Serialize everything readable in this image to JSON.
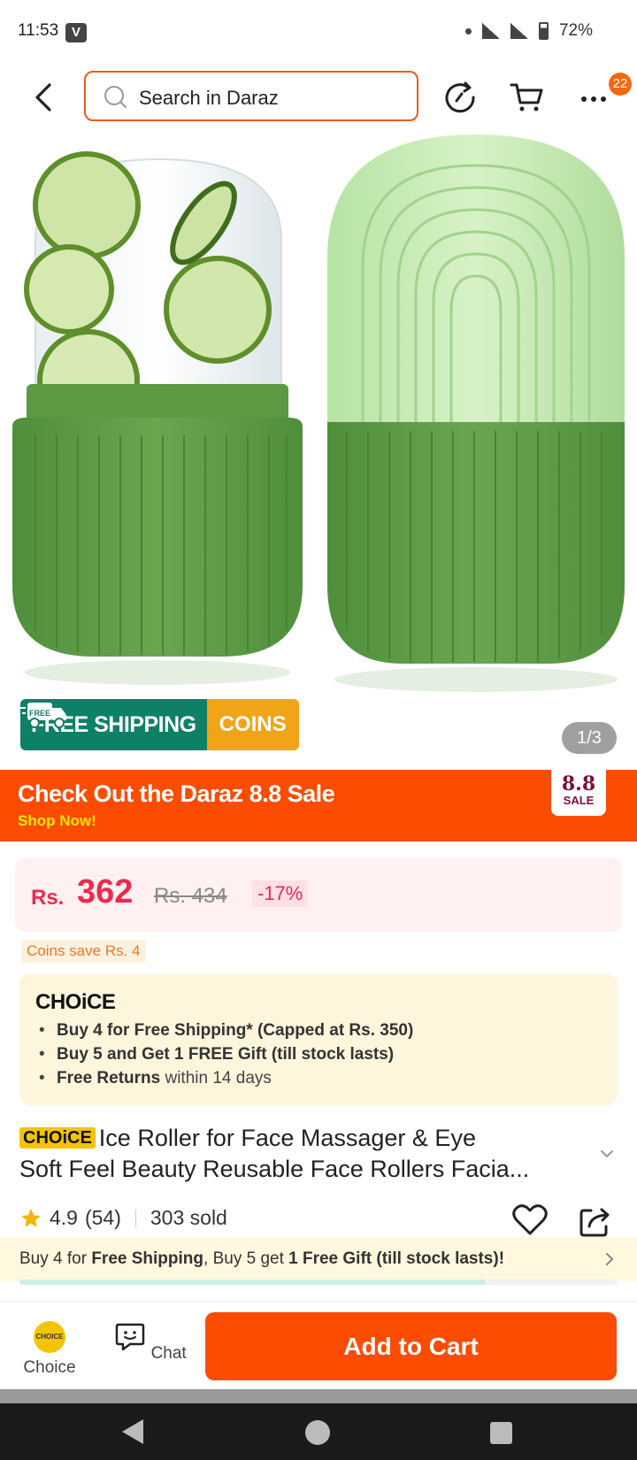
{
  "status": {
    "time": "11:53",
    "badge": "V",
    "battery": "72%"
  },
  "search": {
    "placeholder": "Search in Daraz"
  },
  "header": {
    "cart_badge": "22"
  },
  "gallery": {
    "counter": "1/3",
    "ship_tag": "FREE",
    "ship_label": "FREE SHIPPING",
    "coins_label": "COINS"
  },
  "sale": {
    "title": "Check Out the  Daraz 8.8 Sale",
    "cta": "Shop Now!",
    "logo_num": "8.8",
    "logo_word": "SALE"
  },
  "price": {
    "currency": "Rs.",
    "value": "362",
    "old": "Rs. 434",
    "discount": "-17%",
    "coins_save": "Coins save Rs. 4"
  },
  "choice": {
    "logo": "CHOiCE",
    "items": [
      {
        "bold": "Buy 4 for  Free Shipping* (Capped at Rs. 350)",
        "rest": ""
      },
      {
        "bold": "Buy 5 and Get 1 FREE Gift (till stock lasts)",
        "rest": ""
      },
      {
        "bold": "Free Returns",
        "rest": " within 14 days"
      }
    ]
  },
  "product": {
    "badge": "CHOiCE",
    "title_line1": "Ice Roller for Face Massager & Eye",
    "title_line2": "Soft Feel Beauty  Reusable Face Rollers Facia...",
    "rating": "4.9",
    "reviews": "(54)",
    "sold": "303 sold"
  },
  "promo": {
    "p1": "Buy 4 for ",
    "b1": "Free Shipping",
    "p2": ", Buy 5 get ",
    "b2": "1 Free Gift (till stock lasts)!",
    "progress": 0.78
  },
  "bottom": {
    "choice_label": "Choice",
    "choice_icon_text": "CHOICE",
    "chat_label": "Chat",
    "cart_label": "Add to Cart"
  },
  "colors": {
    "brand": "#fc4c02",
    "accent_green": "#0e8068",
    "price": "#f0294d"
  }
}
